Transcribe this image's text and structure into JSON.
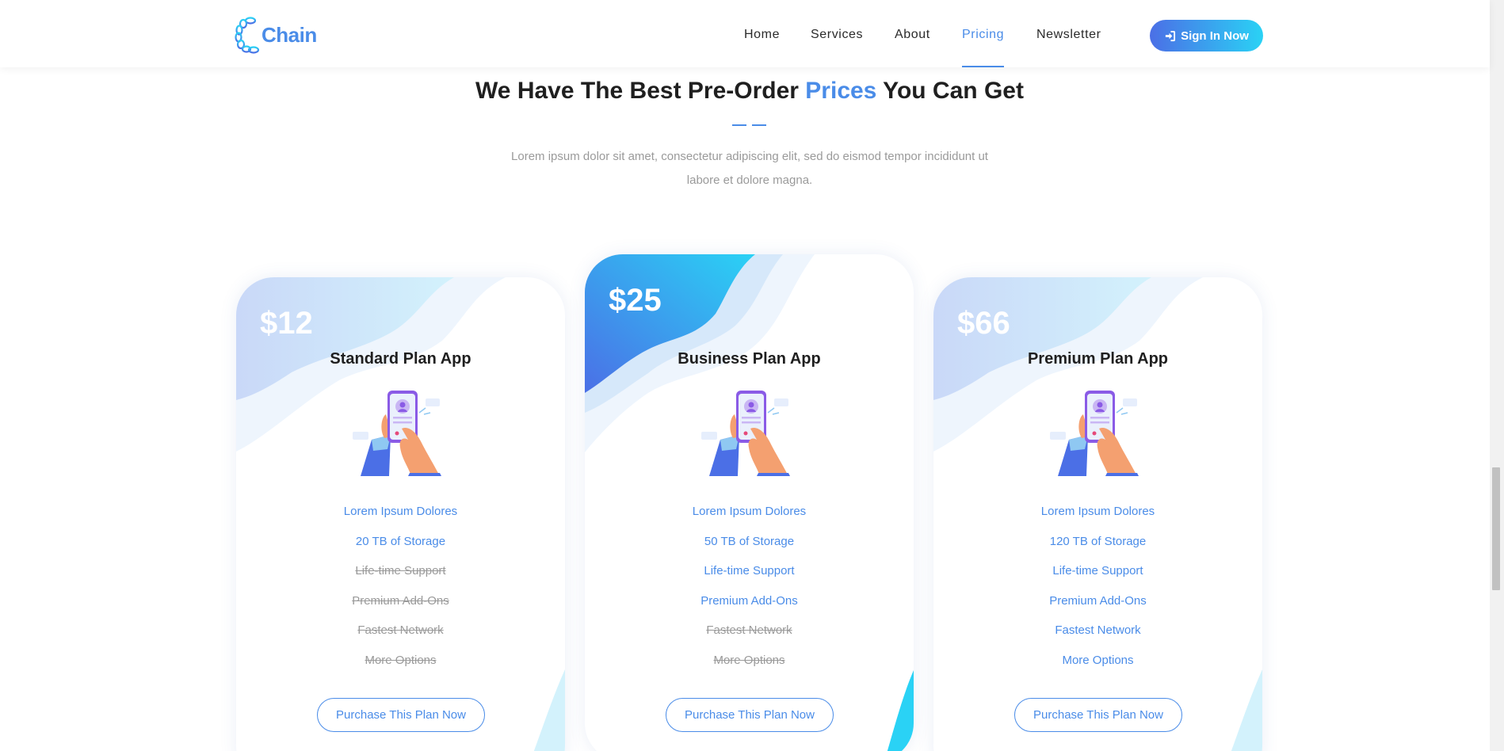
{
  "brand": {
    "name": "Chain",
    "logo_icon": "chain-c-logo-icon",
    "accent": "#4a8ce8"
  },
  "nav": {
    "items": [
      {
        "label": "Home",
        "active": false
      },
      {
        "label": "Services",
        "active": false
      },
      {
        "label": "About",
        "active": false
      },
      {
        "label": "Pricing",
        "active": true
      },
      {
        "label": "Newsletter",
        "active": false
      }
    ],
    "signin_label": "Sign In Now",
    "signin_icon": "sign-in-icon"
  },
  "section": {
    "title_part1": "We Have The Best Pre-Order ",
    "title_highlight": "Prices",
    "title_part2": " You Can Get",
    "subtitle": "Lorem ipsum dolor sit amet, consectetur adipiscing elit, sed do eismod tempor incididunt ut labore et dolore magna."
  },
  "plans": [
    {
      "price": "$12",
      "name": "Standard Plan App",
      "features": [
        {
          "label": "Lorem Ipsum Dolores",
          "included": true
        },
        {
          "label": "20 TB of Storage",
          "included": true
        },
        {
          "label": "Life-time Support",
          "included": false
        },
        {
          "label": "Premium Add-Ons",
          "included": false
        },
        {
          "label": "Fastest Network",
          "included": false
        },
        {
          "label": "More Options",
          "included": false
        }
      ],
      "button_label": "Purchase This Plan Now"
    },
    {
      "price": "$25",
      "name": "Business Plan App",
      "features": [
        {
          "label": "Lorem Ipsum Dolores",
          "included": true
        },
        {
          "label": "50 TB of Storage",
          "included": true
        },
        {
          "label": "Life-time Support",
          "included": true
        },
        {
          "label": "Premium Add-Ons",
          "included": true
        },
        {
          "label": "Fastest Network",
          "included": false
        },
        {
          "label": "More Options",
          "included": false
        }
      ],
      "button_label": "Purchase This Plan Now",
      "featured": true
    },
    {
      "price": "$66",
      "name": "Premium Plan App",
      "features": [
        {
          "label": "Lorem Ipsum Dolores",
          "included": true
        },
        {
          "label": "120 TB of Storage",
          "included": true
        },
        {
          "label": "Life-time Support",
          "included": true
        },
        {
          "label": "Premium Add-Ons",
          "included": true
        },
        {
          "label": "Fastest Network",
          "included": true
        },
        {
          "label": "More Options",
          "included": true
        }
      ],
      "button_label": "Purchase This Plan Now"
    }
  ],
  "colors": {
    "gradient_start": "#4b6fe6",
    "gradient_end": "#2ad2f5",
    "muted_text": "#9a9a9a"
  }
}
